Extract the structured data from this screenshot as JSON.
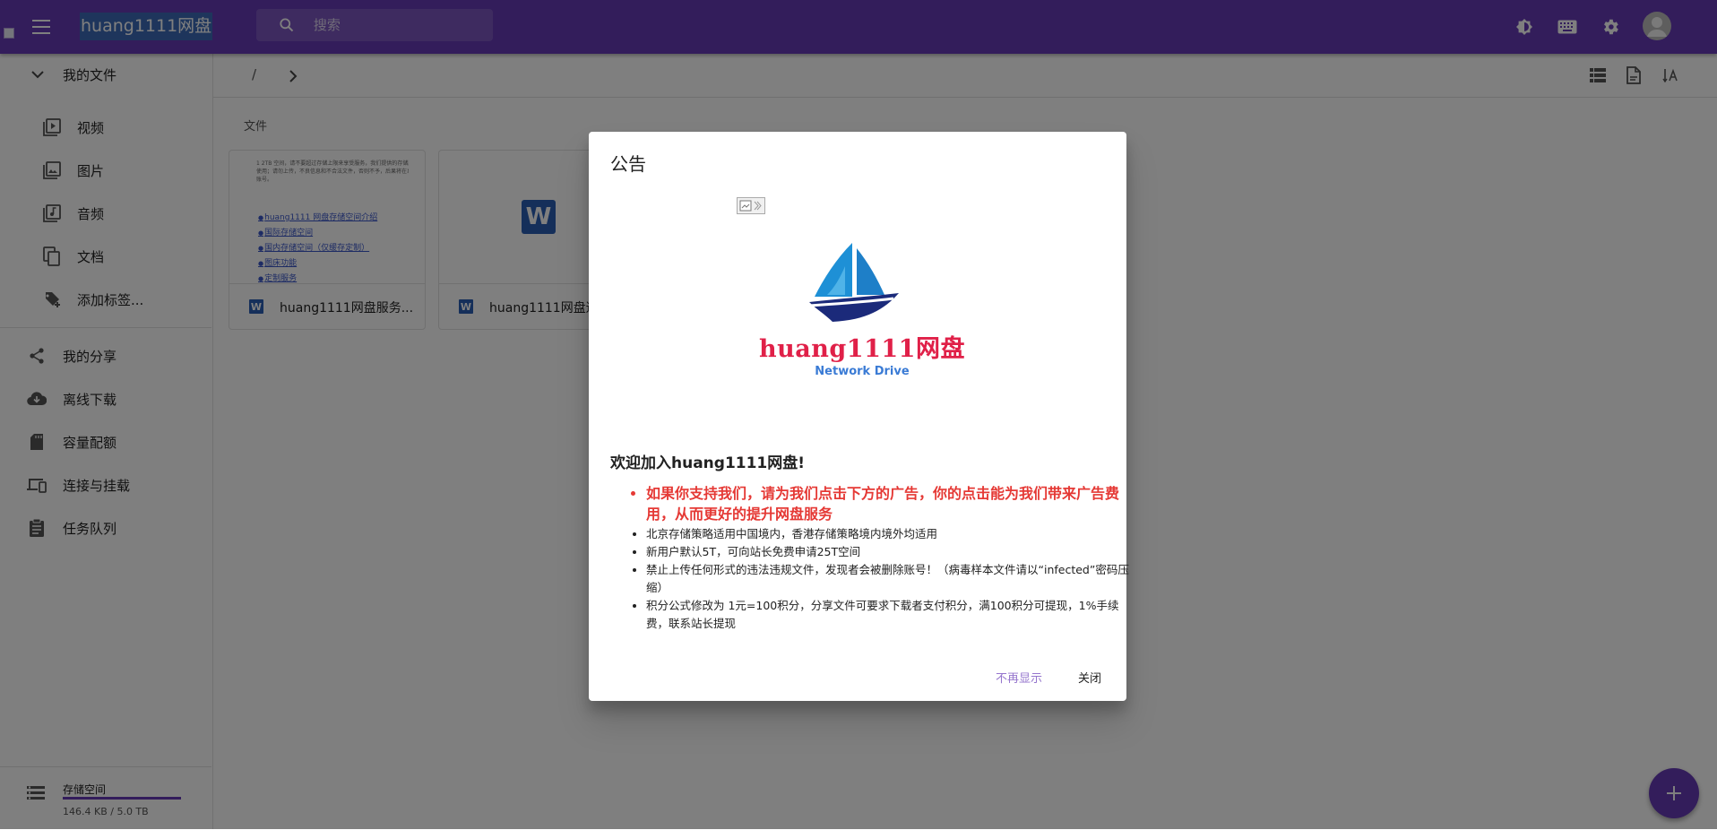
{
  "appbar": {
    "title": "huang1111网盘",
    "search_placeholder": "搜索",
    "icons": [
      "menu-icon",
      "search-icon",
      "theme-toggle-icon",
      "keyboard-icon",
      "settings-icon",
      "account-icon"
    ]
  },
  "sidebar": {
    "my_files": "我的文件",
    "categories": [
      {
        "label": "视频",
        "icon": "video-library-icon"
      },
      {
        "label": "图片",
        "icon": "image-library-icon"
      },
      {
        "label": "音频",
        "icon": "music-library-icon"
      },
      {
        "label": "文档",
        "icon": "documents-icon"
      },
      {
        "label": "添加标签...",
        "icon": "add-tag-icon"
      }
    ],
    "nav": [
      {
        "label": "我的分享",
        "icon": "share-icon"
      },
      {
        "label": "离线下载",
        "icon": "cloud-download-icon"
      },
      {
        "label": "容量配额",
        "icon": "sd-card-icon"
      },
      {
        "label": "连接与挂载",
        "icon": "devices-icon"
      },
      {
        "label": "任务队列",
        "icon": "clipboard-icon"
      }
    ],
    "storage": {
      "title": "存储空间",
      "used": "146.4 KB / 5.0 TB",
      "fraction": 1.0
    }
  },
  "main": {
    "breadcrumb": {
      "root": "/"
    },
    "section_label": "文件",
    "files": [
      {
        "name": "huang1111网盘服务...",
        "badge": "W",
        "preview_lines": [
          "1 2TB 空间，请不要超过存储上限来享受服务，我们提供的存储服务仅为 0.99%。",
          "使用；请勿上传，不良信息和不合法文件，否则不予，后果将在系统检测。",
          "账号。"
        ],
        "preview_links": [
          "huang1111 网盘存储空间介绍",
          "国际存储空间",
          "国内存储空间（仅缓存定制）",
          "图床功能",
          "定制服务"
        ]
      },
      {
        "name": "huang1111网盘适",
        "badge": "W"
      }
    ]
  },
  "dialog": {
    "title": "公告",
    "logo_text": "huang1111网盘",
    "logo_sub": "Network Drive",
    "welcome": "欢迎加入huang1111网盘!",
    "notes": [
      "如果你支持我们，请为我们点击下方的广告，你的点击能为我们带来广告费用，从而更好的提升网盘服务",
      "北京存储策略适用中国境内，香港存储策略境内境外均适用",
      "新用户默认5T，可向站长免费申请25T空间",
      "禁止上传任何形式的违法违规文件，发现者会被删除账号！（病毒样本文件请以“infected”密码压缩）",
      "积分公式修改为 1元=100积分，分享文件可要求下载者支付积分，满100积分可提现，1%手续费，联系站长提现"
    ],
    "buttons": {
      "dont_show": "不再显示",
      "close": "关闭"
    },
    "colors": {
      "highlight": "#e53935",
      "accent": "#673ab7"
    }
  }
}
